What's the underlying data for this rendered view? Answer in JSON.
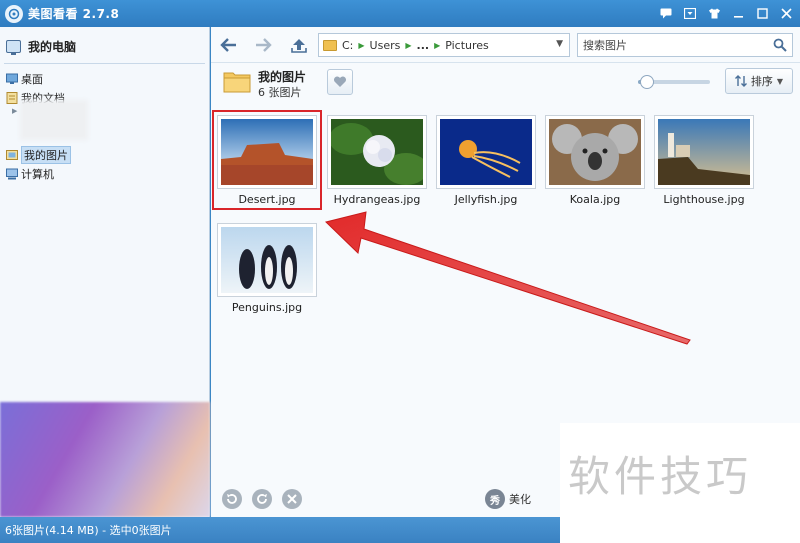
{
  "window": {
    "title": "美图看看 2.7.8"
  },
  "sidebar": {
    "computer_label": "我的电脑",
    "items": [
      {
        "label": "桌面"
      },
      {
        "label": "我的文档"
      },
      {
        "label": "我的图片",
        "selected": true
      },
      {
        "label": "计算机"
      }
    ]
  },
  "toolbar": {
    "path": [
      "C:",
      "Users",
      "...",
      "Pictures"
    ],
    "search_placeholder": "搜索图片"
  },
  "folder": {
    "name": "我的图片",
    "count_label": "6 张图片",
    "zoom_level": 0.12,
    "sort_label": "排序"
  },
  "files": [
    {
      "name": "Desert.jpg",
      "selected_highlight": true
    },
    {
      "name": "Hydrangeas.jpg"
    },
    {
      "name": "Jellyfish.jpg"
    },
    {
      "name": "Koala.jpg"
    },
    {
      "name": "Lighthouse.jpg"
    },
    {
      "name": "Penguins.jpg"
    }
  ],
  "bottom": {
    "beautify_label": "美化"
  },
  "status": {
    "text": "6张图片(4.14 MB) - 选中0张图片"
  },
  "watermark": {
    "text": "软件技巧"
  },
  "colors": {
    "highlight_red": "#d9252a",
    "titlebar": "#3a86c6"
  }
}
